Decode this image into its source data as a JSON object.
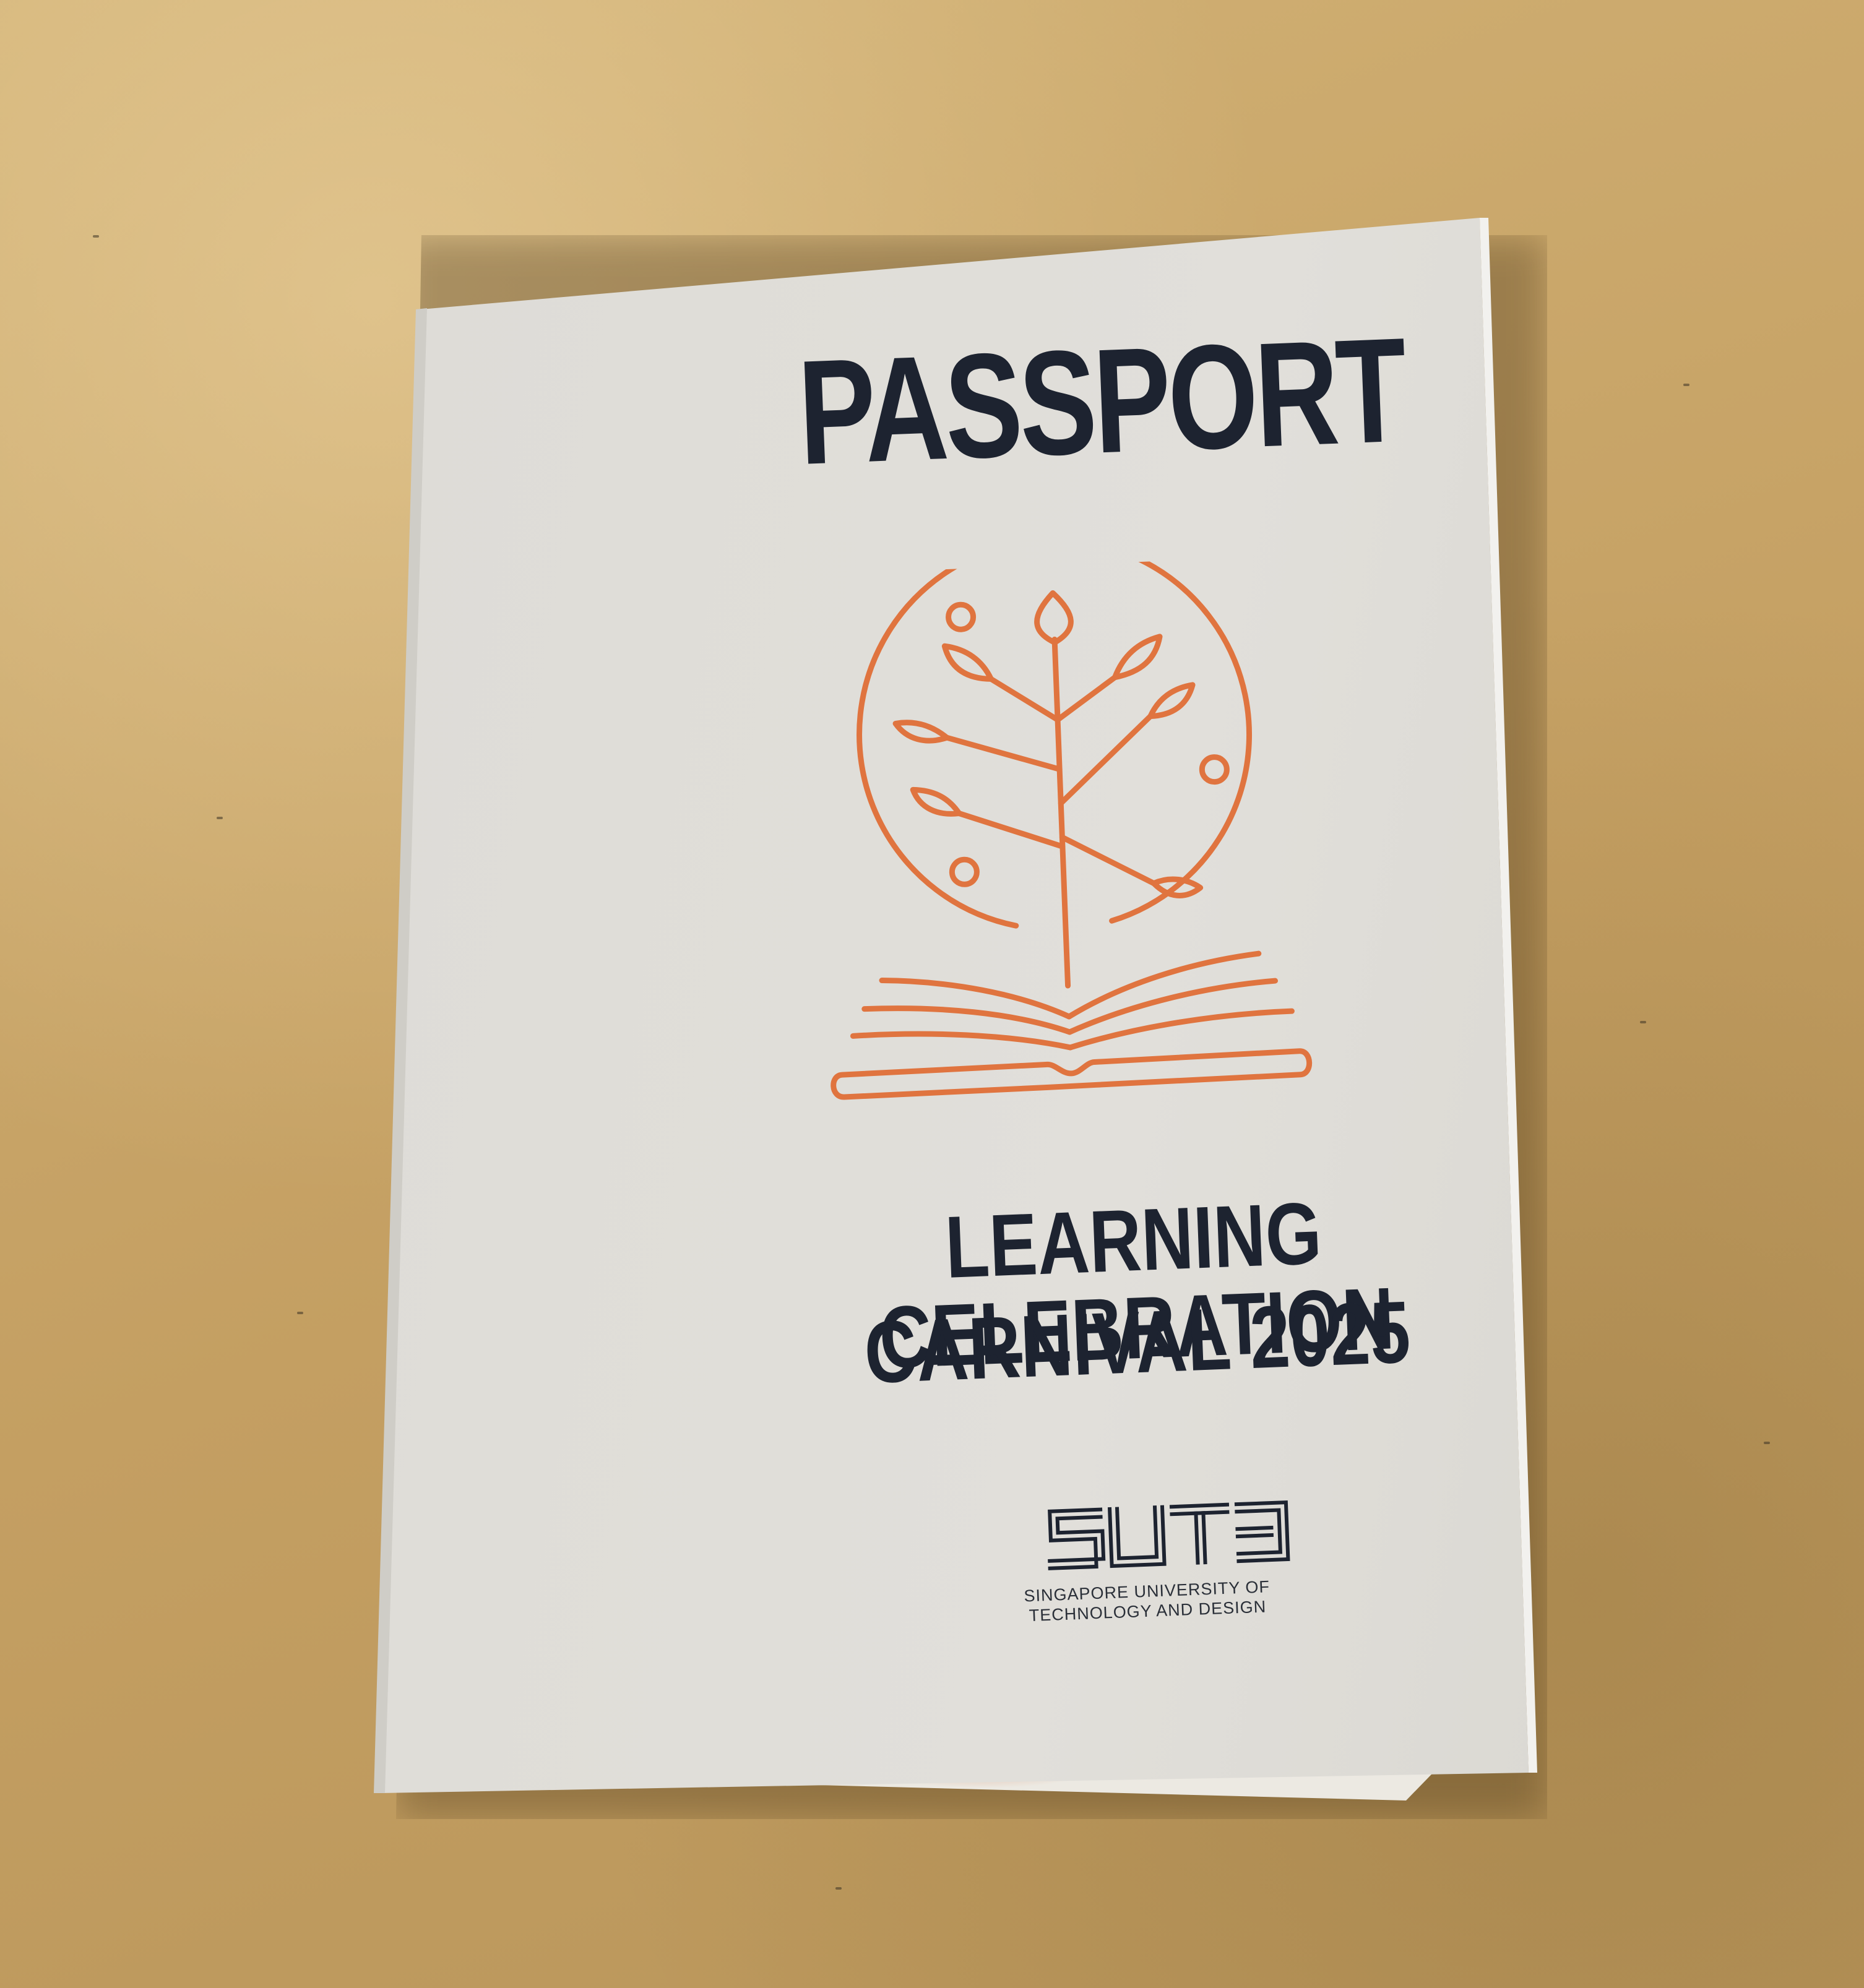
{
  "booklet": {
    "title": "PASSPORT",
    "subtitle_line1": "LEARNING CELEBRATION",
    "subtitle_line2": "CARNIVAL 2025",
    "institution_line1": "SINGAPORE UNIVERSITY OF",
    "institution_line2": "TECHNOLOGY AND DESIGN",
    "logo_text": "SUTD"
  },
  "icons": {
    "emblem": "tree-growing-from-open-book-icon",
    "logo": "university-logo-icon"
  },
  "colors": {
    "background": "#c9a66a",
    "cover": "#dedcd7",
    "title_text": "#1d2330",
    "emblem_accent": "#e0743f"
  }
}
